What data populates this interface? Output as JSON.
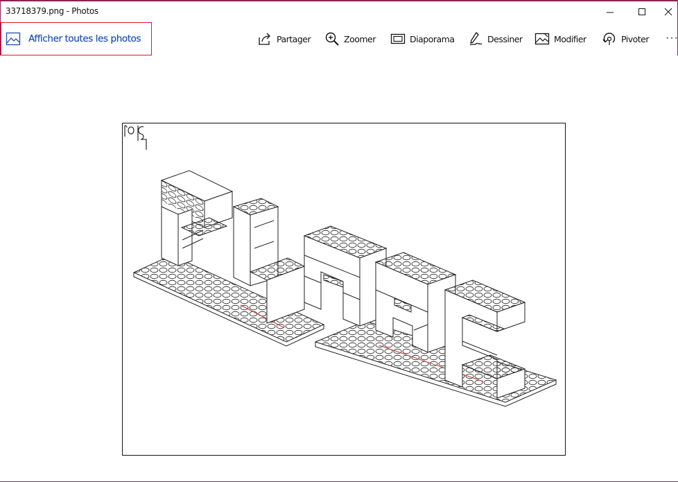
{
  "window": {
    "title": "33718379.png - Photos",
    "frame_color": "#8b2252"
  },
  "window_controls": {
    "minimize_icon": "minimize-icon",
    "maximize_icon": "maximize-icon",
    "close_icon": "close-icon"
  },
  "toolbar": {
    "show_all_label": "Afficher toutes les photos",
    "share_label": "Partager",
    "zoom_label": "Zoomer",
    "slideshow_label": "Diaporama",
    "draw_label": "Dessiner",
    "edit_label": "Modifier",
    "rotate_label": "Pivoter",
    "more_label": "···",
    "accent_color": "#1f4fb4",
    "focus_border_color": "#e81123"
  },
  "photo": {
    "content": "lego-brick-letters-line-drawing",
    "corner_glyphs": "01"
  }
}
